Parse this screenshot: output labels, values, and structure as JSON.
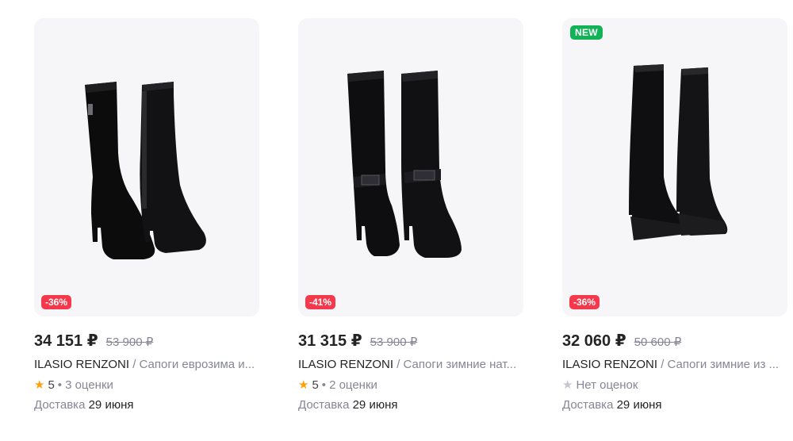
{
  "products": [
    {
      "badge_new": "",
      "discount": "-36%",
      "price": "34 151 ₽",
      "old_price": "53 900 ₽",
      "brand": "ILASIO RENZONI",
      "separator": " / ",
      "name": "Сапоги еврозима и...",
      "rating_value": "5",
      "rating_dot": " • ",
      "reviews": "3 оценки",
      "delivery_label": "Доставка",
      "delivery_date": "29 июня",
      "star_icon": "star-filled"
    },
    {
      "badge_new": "",
      "discount": "-41%",
      "price": "31 315 ₽",
      "old_price": "53 900 ₽",
      "brand": "ILASIO RENZONI",
      "separator": " / ",
      "name": "Сапоги зимние нат...",
      "rating_value": "5",
      "rating_dot": " • ",
      "reviews": "2 оценки",
      "delivery_label": "Доставка",
      "delivery_date": "29 июня",
      "star_icon": "star-filled"
    },
    {
      "badge_new": "NEW",
      "discount": "-36%",
      "price": "32 060 ₽",
      "old_price": "50 600 ₽",
      "brand": "ILASIO RENZONI",
      "separator": " / ",
      "name": "Сапоги зимние из ...",
      "rating_value": "",
      "rating_dot": "",
      "reviews": "Нет оценок",
      "delivery_label": "Доставка",
      "delivery_date": "29 июня",
      "star_icon": "star-empty"
    }
  ],
  "colors": {
    "discount_badge": "#f5384b",
    "new_badge": "#12b257",
    "star_filled": "#ff9f0a",
    "star_empty": "#c6c6cf",
    "image_background": "#f6f6f9"
  }
}
